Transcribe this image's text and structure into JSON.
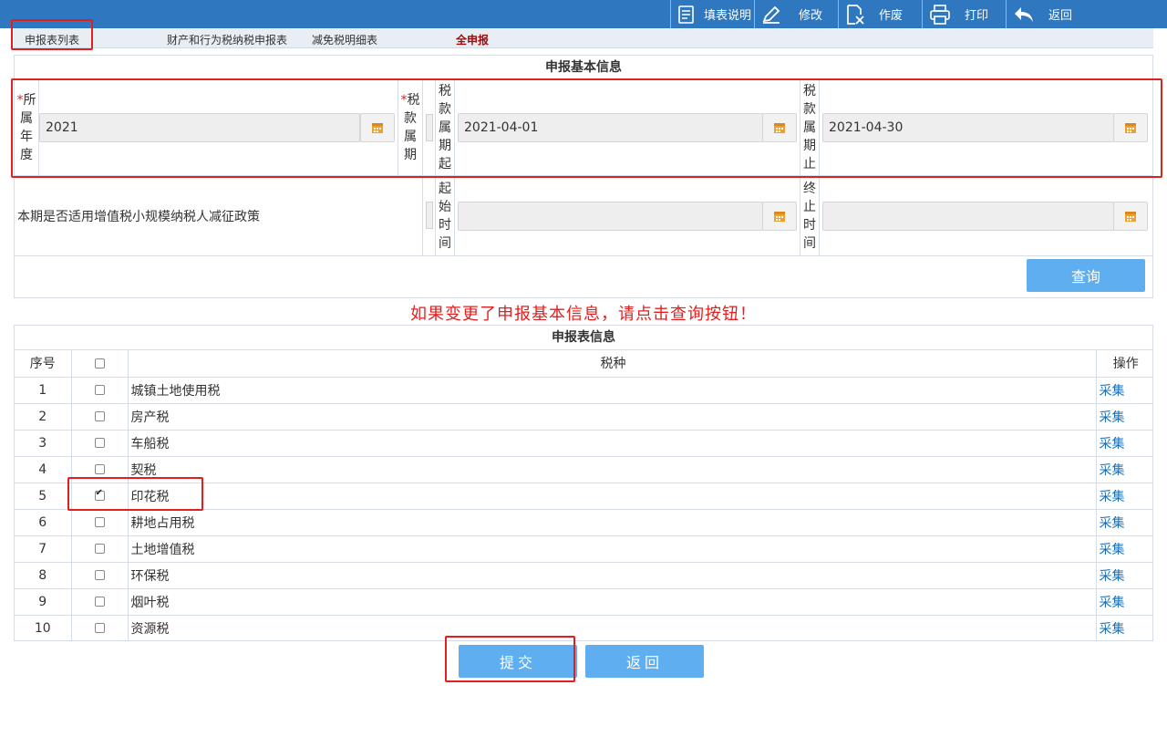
{
  "toolbar": {
    "fill_instructions": "填表说明",
    "modify": "修改",
    "void": "作废",
    "print": "打印",
    "back": "返回"
  },
  "tabs": [
    {
      "label": "申报表列表"
    },
    {
      "label": "财产和行为税纳税申报表"
    },
    {
      "label": "减免税明细表"
    },
    {
      "label": "全申报"
    }
  ],
  "basic_info": {
    "title": "申报基本信息",
    "year_label_req": "*",
    "year_label": [
      "所",
      "属",
      "年",
      "度"
    ],
    "year_value": "2021",
    "period_label_req": "*",
    "period_label": [
      "税",
      "款",
      "属",
      "期"
    ],
    "start_label": [
      "税",
      "款",
      "属",
      "期",
      "起"
    ],
    "start_value": "2021-04-01",
    "end_label": [
      "税",
      "款",
      "属",
      "期",
      "止"
    ],
    "end_value": "2021-04-30",
    "policy_label": "本期是否适用增值税小规模纳税人减征政策",
    "policy_start_label": [
      "起",
      "始",
      "时",
      "间"
    ],
    "policy_start_value": "",
    "policy_end_label": [
      "终",
      "止",
      "时",
      "间"
    ],
    "policy_end_value": "",
    "query_button": "查询"
  },
  "notice": "如果变更了申报基本信息，请点击查询按钮！",
  "table": {
    "title": "申报表信息",
    "headers": {
      "no": "序号",
      "tax": "税种",
      "op": "操作"
    },
    "rows": [
      {
        "no": "1",
        "name": "城镇土地使用税",
        "checked": false,
        "op": "采集"
      },
      {
        "no": "2",
        "name": "房产税",
        "checked": false,
        "op": "采集"
      },
      {
        "no": "3",
        "name": "车船税",
        "checked": false,
        "op": "采集"
      },
      {
        "no": "4",
        "name": "契税",
        "checked": false,
        "op": "采集"
      },
      {
        "no": "5",
        "name": "印花税",
        "checked": true,
        "op": "采集"
      },
      {
        "no": "6",
        "name": "耕地占用税",
        "checked": false,
        "op": "采集"
      },
      {
        "no": "7",
        "name": "土地增值税",
        "checked": false,
        "op": "采集"
      },
      {
        "no": "8",
        "name": "环保税",
        "checked": false,
        "op": "采集"
      },
      {
        "no": "9",
        "name": "烟叶税",
        "checked": false,
        "op": "采集"
      },
      {
        "no": "10",
        "name": "资源税",
        "checked": false,
        "op": "采集"
      }
    ]
  },
  "footer": {
    "submit": "提交",
    "back": "返回"
  },
  "colors": {
    "toolbar_bg": "#2f78bf",
    "button_blue": "#5eaef0",
    "highlight_red": "#e0201f",
    "notice_red": "#e02020",
    "link_blue": "#1a6fb6",
    "active_tab": "#9c0a0a",
    "calendar_orange": "#f0a030"
  }
}
